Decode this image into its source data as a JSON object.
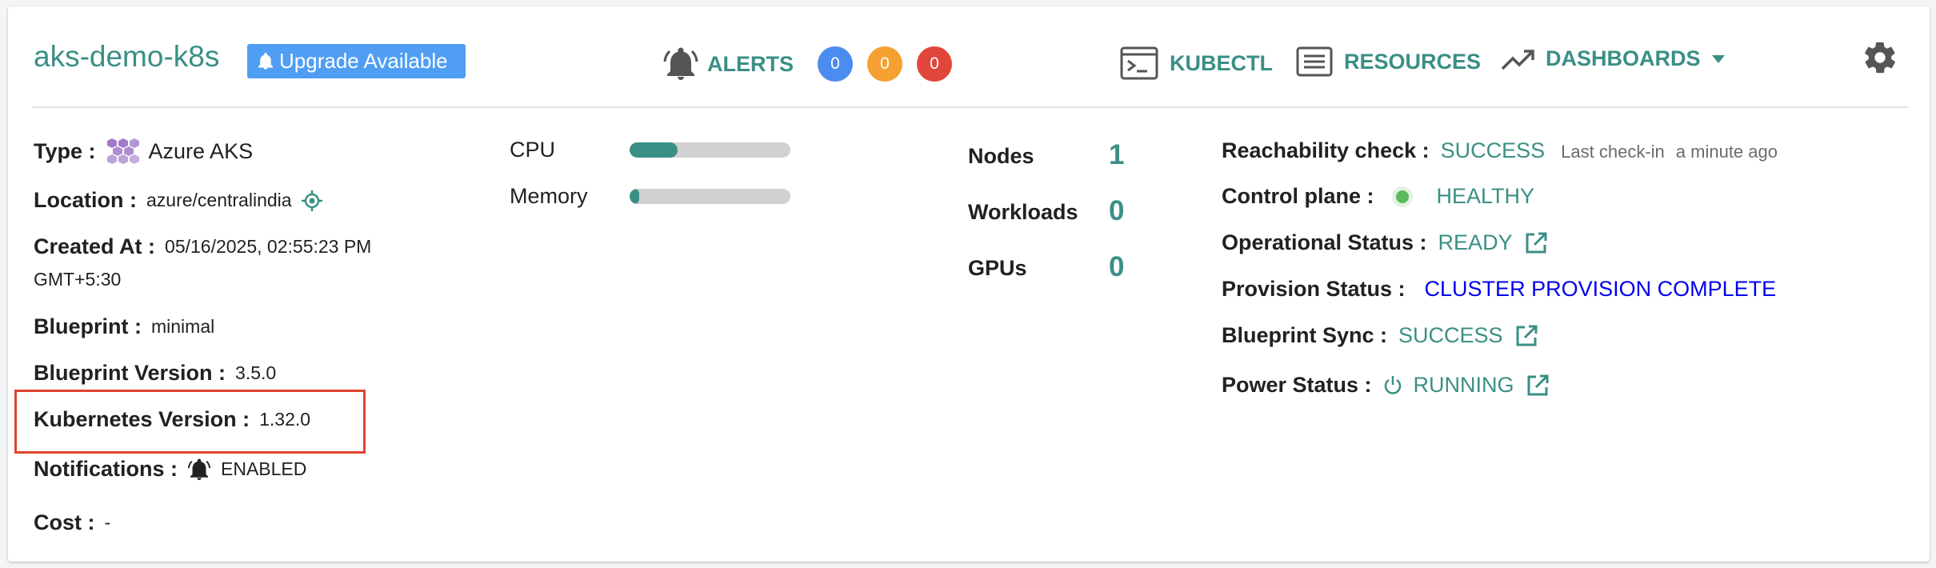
{
  "header": {
    "cluster_name": "aks-demo-k8s",
    "upgrade_label": "Upgrade Available",
    "alerts_label": "ALERTS",
    "alert_counts": [
      {
        "value": "0",
        "color": "#4a8cf0"
      },
      {
        "value": "0",
        "color": "#f5a031"
      },
      {
        "value": "0",
        "color": "#e2463b"
      }
    ],
    "kubectl_label": "KUBECTL",
    "resources_label": "RESOURCES",
    "dashboards_label": "DASHBOARDS",
    "icons": [
      "bell-icon",
      "terminal-icon",
      "list-icon",
      "trending-up-icon",
      "caret-down-icon",
      "gear-icon"
    ]
  },
  "details": {
    "type_label": "Type :",
    "type_value": "Azure AKS",
    "location_label": "Location :",
    "location_value": "azure/centralindia",
    "created_label": "Created At :",
    "created_value_line1": "05/16/2025, 02:55:23 PM",
    "created_value_line2": "GMT+5:30",
    "blueprint_label": "Blueprint :",
    "blueprint_value": "minimal",
    "blueprint_version_label": "Blueprint Version :",
    "blueprint_version_value": "3.5.0",
    "k8s_version_label": "Kubernetes Version :",
    "k8s_version_value": "1.32.0",
    "notifications_label": "Notifications :",
    "notifications_value": "ENABLED",
    "cost_label": "Cost :",
    "cost_value": "-"
  },
  "usage": {
    "cpu_label": "CPU",
    "cpu_fraction": 0.3,
    "memory_label": "Memory",
    "memory_fraction": 0.06
  },
  "stats": {
    "nodes_label": "Nodes",
    "nodes_value": "1",
    "workloads_label": "Workloads",
    "workloads_value": "0",
    "gpus_label": "GPUs",
    "gpus_value": "0"
  },
  "status": {
    "reachability_label": "Reachability check :",
    "reachability_value": "SUCCESS",
    "last_checkin_label": "Last check-in",
    "last_checkin_value": "a minute ago",
    "control_plane_label": "Control plane :",
    "control_plane_value": "HEALTHY",
    "operational_label": "Operational Status :",
    "operational_value": "READY",
    "provision_label": "Provision Status :",
    "provision_value": "CLUSTER PROVISION COMPLETE",
    "blueprint_sync_label": "Blueprint Sync :",
    "blueprint_sync_value": "SUCCESS",
    "power_label": "Power Status :",
    "power_value": "RUNNING",
    "healthy_dot_color": "#5cb85c"
  }
}
